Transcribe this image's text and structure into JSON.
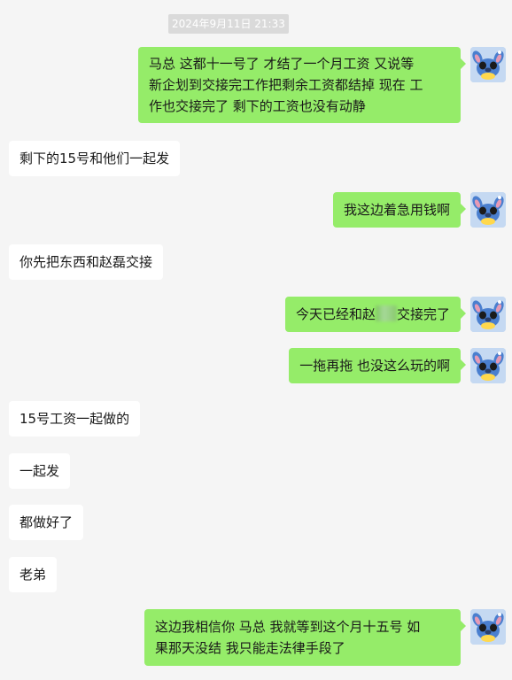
{
  "chat": {
    "timestamp": "2024年9月11日 21:33",
    "messages": [
      {
        "from": "me",
        "lines": [
          "马总 这都十一号了 才结了一个月工资 又说等",
          "新企划到交接完工作把剩余工资都结掉 现在 工",
          "作也交接完了 剩下的工资也没有动静"
        ]
      },
      {
        "from": "other",
        "text": "剩下的15号和他们一起发"
      },
      {
        "from": "me",
        "text": "我这边着急用钱啊"
      },
      {
        "from": "other",
        "text": "你先把东西和赵磊交接"
      },
      {
        "from": "me",
        "text_before": "今天已经和赵",
        "text_after": "交接完了"
      },
      {
        "from": "me",
        "text": "一拖再拖 也没这么玩的啊"
      },
      {
        "from": "other",
        "text": "15号工资一起做的"
      },
      {
        "from": "other",
        "text": "一起发"
      },
      {
        "from": "other",
        "text": "都做好了"
      },
      {
        "from": "other",
        "text": "老弟"
      },
      {
        "from": "me",
        "lines": [
          "这边我相信你 马总  我就等到这个月十五号 如",
          "果那天没结 我只能走法律手段了"
        ]
      }
    ]
  },
  "colors": {
    "self_bubble": "#95ec69",
    "other_bubble": "#ffffff",
    "background": "#f5f5f5"
  },
  "icons": {
    "avatar": "stitch-avatar-icon"
  }
}
